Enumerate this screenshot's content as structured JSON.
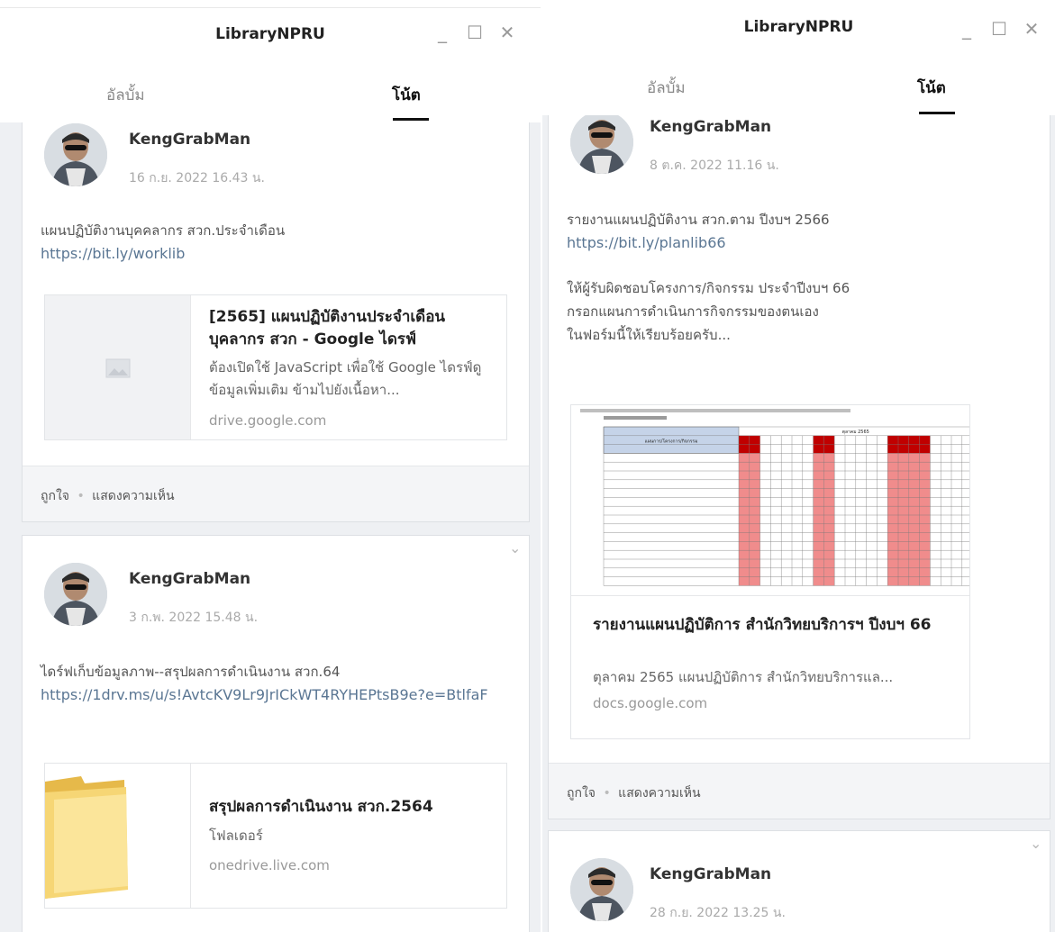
{
  "left_window": {
    "title": "LibraryNPRU",
    "tabs": {
      "album": "อัลบั้ม",
      "notes": "โน้ต"
    },
    "window_controls": {
      "minimize": "_",
      "maximize": "☐",
      "close": "✕"
    },
    "posts": [
      {
        "author": "KengGrabMan",
        "timestamp": "16 ก.ย. 2022 16.43 น.",
        "text": "แผนปฏิบัติงานบุคคลากร สวก.ประจำเดือน",
        "link": "https://bit.ly/worklib",
        "preview": {
          "title": "[2565] แผนปฏิบัติงานประจำเดือน บุคลากร สวก - Google ไดรฟ์",
          "description": "ต้องเปิดใช้ JavaScript เพื่อใช้ Google ไดรฟ์ดูข้อมูลเพิ่มเติม ข้ามไปยังเนื้อหา...",
          "domain": "drive.google.com",
          "thumb_icon": "image-placeholder-icon"
        },
        "footer": {
          "like": "ถูกใจ",
          "separator": "•",
          "comment": "แสดงความเห็น"
        }
      },
      {
        "author": "KengGrabMan",
        "timestamp": "3 ก.พ. 2022 15.48 น.",
        "text": "ไดร์ฟเก็บข้อมูลภาพ--สรุปผลการดำเนินงาน สวก.64",
        "link": "https://1drv.ms/u/s!AvtcKV9Lr9JrICkWT4RYHEPtsB9e?e=BtlfaF",
        "preview": {
          "title": "สรุปผลการดำเนินงาน สวก.2564",
          "description": "โฟลเดอร์",
          "domain": "onedrive.live.com",
          "thumb_icon": "folder-icon"
        }
      }
    ]
  },
  "right_window": {
    "title": "LibraryNPRU",
    "tabs": {
      "album": "อัลบั้ม",
      "notes": "โน้ต"
    },
    "window_controls": {
      "minimize": "_",
      "maximize": "☐",
      "close": "✕"
    },
    "posts": [
      {
        "author": "KengGrabMan",
        "timestamp": "8 ต.ค. 2022 11.16 น.",
        "text": "รายงานแผนปฏิบัติงาน สวก.ตาม ปีงบฯ 2566",
        "link": "https://bit.ly/planlib66",
        "text2_line1": "ให้ผู้รับผิดชอบโครงการ/กิจกรรม ประจำปีงบฯ 66",
        "text2_line2": "กรอกแผนการดำเนินการกิจกรรมของตนเอง",
        "text2_line3": "ในฟอร์มนี้ให้เรียบร้อยครับ...",
        "preview": {
          "title": "รายงานแผนปฏิบัติการ สำนักวิทยบริการฯ ปีงบฯ 66",
          "description": "ตุลาคม 2565 แผนปฏิบัติการ สำนักวิทยบริการแล...",
          "domain": "docs.google.com",
          "sheet_header": "ตุลาคม 2565",
          "sheet_col_label": "แผนการ/โครงการ/กิจกรรม"
        },
        "footer": {
          "like": "ถูกใจ",
          "separator": "•",
          "comment": "แสดงความเห็น"
        }
      },
      {
        "author": "KengGrabMan",
        "timestamp": "28 ก.ย. 2022 13.25 น."
      }
    ]
  },
  "colors": {
    "link": "#5a7693",
    "feed_bg": "#eef0f3",
    "sheet_red": "#f08c8c",
    "sheet_dark_red": "#c00000"
  }
}
